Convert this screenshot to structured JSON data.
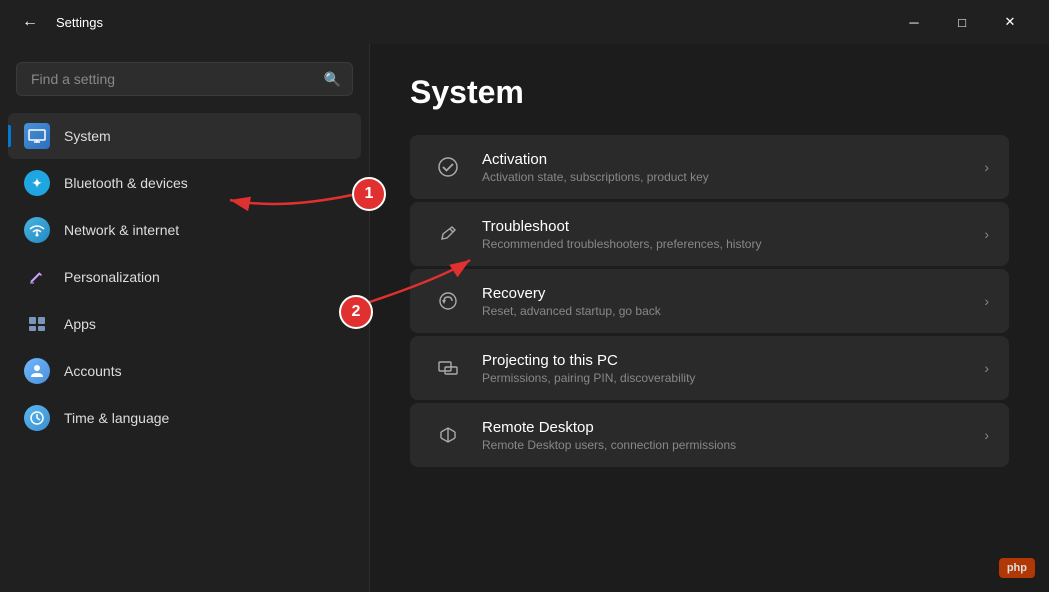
{
  "titlebar": {
    "back_label": "←",
    "title": "Settings",
    "minimize_label": "─",
    "maximize_label": "□",
    "close_label": "✕"
  },
  "sidebar": {
    "search_placeholder": "Find a setting",
    "search_icon": "🔍",
    "items": [
      {
        "id": "system",
        "label": "System",
        "icon": "💻",
        "icon_type": "system-icon",
        "active": true
      },
      {
        "id": "bluetooth",
        "label": "Bluetooth & devices",
        "icon": "✦",
        "icon_type": "bluetooth-icon",
        "active": false
      },
      {
        "id": "network",
        "label": "Network & internet",
        "icon": "◈",
        "icon_type": "network-icon",
        "active": false
      },
      {
        "id": "personalization",
        "label": "Personalization",
        "icon": "✏",
        "icon_type": "personalization-icon",
        "active": false
      },
      {
        "id": "apps",
        "label": "Apps",
        "icon": "⊞",
        "icon_type": "apps-icon",
        "active": false
      },
      {
        "id": "accounts",
        "label": "Accounts",
        "icon": "👤",
        "icon_type": "accounts-icon",
        "active": false
      },
      {
        "id": "time",
        "label": "Time & language",
        "icon": "🌐",
        "icon_type": "time-icon",
        "active": false
      }
    ]
  },
  "main": {
    "page_title": "System",
    "settings_items": [
      {
        "id": "activation",
        "title": "Activation",
        "description": "Activation state, subscriptions, product key",
        "icon": "✓"
      },
      {
        "id": "troubleshoot",
        "title": "Troubleshoot",
        "description": "Recommended troubleshooters, preferences, history",
        "icon": "🔧"
      },
      {
        "id": "recovery",
        "title": "Recovery",
        "description": "Reset, advanced startup, go back",
        "icon": "↺"
      },
      {
        "id": "projecting",
        "title": "Projecting to this PC",
        "description": "Permissions, pairing PIN, discoverability",
        "icon": "⊡"
      },
      {
        "id": "remote-desktop",
        "title": "Remote Desktop",
        "description": "Remote Desktop users, connection permissions",
        "icon": "≫"
      }
    ]
  },
  "annotations": [
    {
      "id": 1,
      "label": "1"
    },
    {
      "id": 2,
      "label": "2"
    }
  ],
  "watermark": "php"
}
